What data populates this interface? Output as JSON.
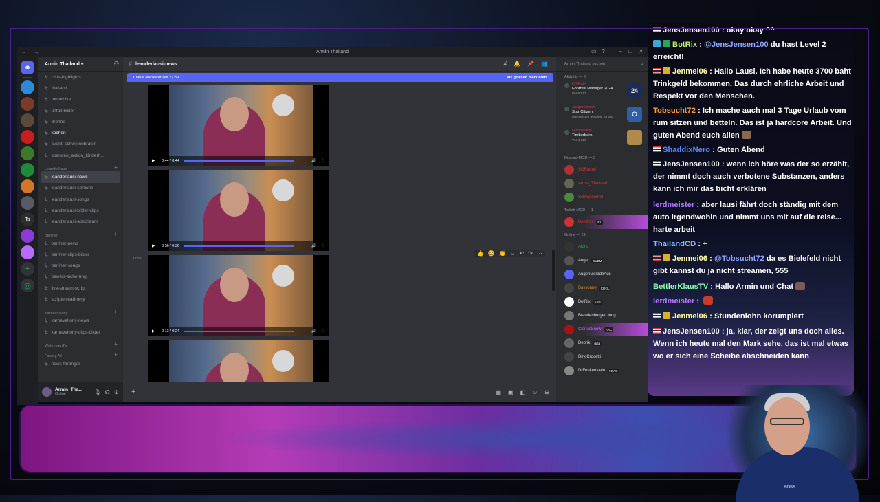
{
  "window": {
    "title": "Armin Thailand",
    "nav": "←  →"
  },
  "server": {
    "name": "Armin Thailand"
  },
  "guild_icons": [
    {
      "label": "",
      "color": "#2a8bd6"
    },
    {
      "label": "",
      "color": "#7b3b2a"
    },
    {
      "label": "",
      "color": "#5b4a3a"
    },
    {
      "label": "",
      "color": "#c91c1c"
    },
    {
      "label": "",
      "color": "#3b7a2a"
    },
    {
      "label": "",
      "color": "#1f8a3a"
    },
    {
      "label": "",
      "color": "#d4762a"
    },
    {
      "label": "",
      "color": "#555a66"
    },
    {
      "label": "Ts",
      "color": "#2b2d31"
    },
    {
      "label": "",
      "color": "#8a3ad6"
    },
    {
      "label": "",
      "color": "#b56cff"
    }
  ],
  "channels": [
    {
      "type": "ch",
      "name": "clips-highlights"
    },
    {
      "type": "ch",
      "name": "thailand"
    },
    {
      "type": "ch",
      "name": "motorbike"
    },
    {
      "type": "ch",
      "name": "unfall-bilder"
    },
    {
      "type": "ch",
      "name": "drohne"
    },
    {
      "type": "ch",
      "name": "kochen",
      "bold": true
    },
    {
      "type": "ch",
      "name": "event_schweinebraten"
    },
    {
      "type": "ch",
      "name": "spenden_aktion_kinderh..."
    },
    {
      "type": "cat",
      "name": "LeanderLausi"
    },
    {
      "type": "ch",
      "name": "leanderlausi-news",
      "active": true
    },
    {
      "type": "ch",
      "name": "leanderlausi-sprüche"
    },
    {
      "type": "ch",
      "name": "leanderlausi-songs"
    },
    {
      "type": "ch",
      "name": "leanderlausi-bilder-clips"
    },
    {
      "type": "ch",
      "name": "leanderlausi-abschaum"
    },
    {
      "type": "cat",
      "name": "Berliner"
    },
    {
      "type": "ch",
      "name": "berliner-news"
    },
    {
      "type": "ch",
      "name": "berliner-clips-bilder"
    },
    {
      "type": "ch",
      "name": "berliner-songs"
    },
    {
      "type": "ch",
      "name": "beweis-sicherung"
    },
    {
      "type": "ch",
      "name": "live-stream-script"
    },
    {
      "type": "ch",
      "name": "scripte-read-only"
    },
    {
      "type": "cat",
      "name": "KarnevalTony"
    },
    {
      "type": "ch",
      "name": "karnevaltony-news"
    },
    {
      "type": "ch",
      "name": "karnevaltony-clips-bilder"
    },
    {
      "type": "cat",
      "name": "WeltreisenTV"
    },
    {
      "type": "cat",
      "name": "Farang All"
    },
    {
      "type": "ch",
      "name": "news-farangali"
    }
  ],
  "user": {
    "name": "Armin_Tha...",
    "status": "Online"
  },
  "channel": {
    "name": "leanderlausi-news",
    "new_messages": "1 neue Nachricht seit 22:39",
    "mark_read": "Als gelesen markieren"
  },
  "videos": [
    {
      "time": "0:44 / 0:44"
    },
    {
      "time": "0:36 / 0:36"
    },
    {
      "time": "0:13 / 0:24",
      "stamp": "12:52"
    },
    {
      "time": ""
    }
  ],
  "members": {
    "search_placeholder": "Armin Thailand suchen",
    "activity_header": "Aktivität — 3",
    "activities": [
      {
        "who": "DB Fm24",
        "game": "Football Manager 2024",
        "sub": "Vor 8 Std.",
        "art": "24",
        "color": "#1d2b5a"
      },
      {
        "who": "Ausgezeichnet",
        "game": "Star Citizen",
        "sub": "Am meisten gespielt: 38 Std.",
        "art": "⏻",
        "color": "#2f5fa8"
      },
      {
        "who": "Leanderlausi",
        "game": "Timberborn",
        "sub": "Vor 4 Std.",
        "art": "",
        "color": "#b08a4a"
      }
    ],
    "groups": [
      {
        "header": "Discord-MOD — 3",
        "items": [
          {
            "name": "SGRiebel",
            "color": "#da373c",
            "av": "#a33"
          },
          {
            "name": "Armin_Thailand",
            "color": "#da373c",
            "av": "#665"
          },
          {
            "name": "Schweinerhm",
            "color": "#da373c",
            "av": "#4a8a3a"
          }
        ]
      },
      {
        "header": "Twitch-MOD — 1",
        "items": [
          {
            "name": "Bendrox",
            "color": "#da373c",
            "av": "#c33",
            "tag": "RL",
            "hl": true
          }
        ]
      },
      {
        "header": "Online — 29",
        "items": [
          {
            "name": "Aluna",
            "color": "#23a55a",
            "av": "#333"
          },
          {
            "name": "Angel",
            "color": "#dbdee1",
            "av": "#555",
            "tag": "SUBM"
          },
          {
            "name": "AugenGeradeAus",
            "color": "#dbdee1",
            "av": "#5865f2"
          },
          {
            "name": "Baysonne",
            "color": "#d48b2a",
            "av": "#444",
            "tag": "COOL"
          },
          {
            "name": "BotRix",
            "color": "#dbdee1",
            "av": "#fff",
            "tag": "APP"
          },
          {
            "name": "Brandenburger Jung",
            "color": "#dbdee1",
            "av": "#777"
          },
          {
            "name": "ClanusSnow",
            "color": "#c06bff",
            "av": "#a11",
            "tag": "ARC",
            "hl": true
          },
          {
            "name": "Deorik",
            "color": "#dbdee1",
            "av": "#666",
            "tag": "data"
          },
          {
            "name": "DinoCrocetti",
            "color": "#dbdee1",
            "av": "#444"
          },
          {
            "name": "DrFunkenstein",
            "color": "#dbdee1",
            "av": "#888",
            "tag": "9GAG"
          }
        ]
      }
    ]
  },
  "chat": [
    {
      "flag": true,
      "badges": [],
      "user": "JensJensen100",
      "ucolor": "#ffffff",
      "text": " : okay okay ^^"
    },
    {
      "flag": false,
      "badges": [
        "#3aa7d6",
        "#23a55a"
      ],
      "user": "BotRix",
      "ucolor": "#b9f56a",
      "text": " : ",
      "mention": "@JensJensen100",
      "rest": " du hast Level 2 erreicht!"
    },
    {
      "flag": true,
      "badges": [
        "#d8b02a"
      ],
      "user": "Jenmei06",
      "ucolor": "#ffffa0",
      "text": " : Hallo Lausi. Ich habe heute 3700 baht Trinkgeld bekommen. Das durch ehrliche Arbeit und Respekt vor den Menschen."
    },
    {
      "flag": false,
      "badges": [],
      "user": "Tobsucht72",
      "ucolor": "#ff9b3a",
      "text": " : Ich mache auch mal 3 Tage Urlaub vom rum sitzen und betteln. Das ist ja hardcore Arbeit. Und guten Abend euch allen",
      "emo": "#8a6a4a"
    },
    {
      "flag": true,
      "badges": [],
      "user": "ShaddixNero",
      "ucolor": "#5a8aff",
      "text": " : Guten Abend"
    },
    {
      "flag": true,
      "badges": [],
      "user": "JensJensen100",
      "ucolor": "#ffffff",
      "text": " : wenn ich höre was der so erzählt, der nimmt doch auch verbotene Substanzen, anders kann ich mir das bicht erklären"
    },
    {
      "flag": false,
      "badges": [],
      "user": "lerdmeister",
      "ucolor": "#b07aff",
      "text": " : aber lausi fährt doch ständig mit dem auto irgendwohin und nimmt uns mit auf die reise... harte arbeit"
    },
    {
      "flag": false,
      "badges": [],
      "user": "ThailandCD",
      "ucolor": "#8ab8ff",
      "text": " : +"
    },
    {
      "flag": true,
      "badges": [
        "#d8b02a"
      ],
      "user": "Jenmei06",
      "ucolor": "#ffffa0",
      "text": " : ",
      "mention": "@Tobsucht72",
      "rest": " da es Bielefeld nicht gibt kannst du ja nicht streamen, 555"
    },
    {
      "flag": false,
      "badges": [],
      "user": "BettlerKlausTV",
      "ucolor": "#8affb0",
      "text": " : Hallo Armin und Chat",
      "emo": "#7a5a5a"
    },
    {
      "flag": false,
      "badges": [],
      "user": "lerdmeister",
      "ucolor": "#b07aff",
      "text": " : ",
      "emo": "#c83a2a"
    },
    {
      "flag": true,
      "badges": [
        "#d8b02a"
      ],
      "user": "Jenmei06",
      "ucolor": "#ffffa0",
      "text": " : Stundenlohn korumpiert"
    },
    {
      "flag": true,
      "badges": [],
      "user": "JensJensen100",
      "ucolor": "#ffffff",
      "text": " : ja, klar, der zeigt uns doch alles. Wenn ich heute mal den Mark sehe, das ist mal etwas wo er sich eine Scheibe abschneiden kann"
    }
  ],
  "cam": {
    "shirt_text": "BOSS"
  },
  "accent": {
    "blurple": "#5865f2",
    "banner": "#b43cb6"
  }
}
